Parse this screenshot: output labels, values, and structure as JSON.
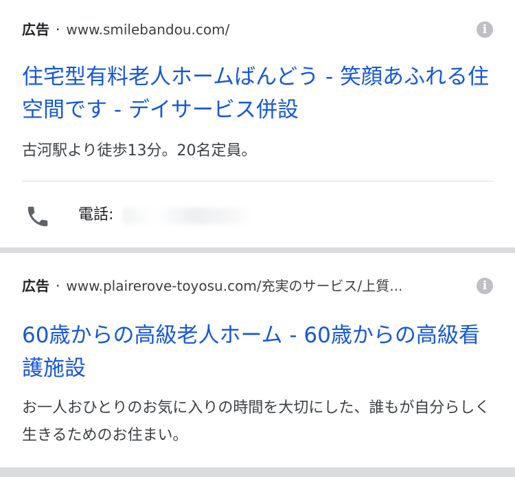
{
  "ads": [
    {
      "label": "広告",
      "separator": "·",
      "url": "www.smilebandou.com/",
      "title": "住宅型有料老人ホームばんどう - 笑顔あふれる住空間です - デイサービス併設",
      "description": "古河駅より徒歩13分。20名定員。",
      "phone_label": "電話:",
      "phone_icon": "phone-icon",
      "info_icon": "info-icon"
    },
    {
      "label": "広告",
      "separator": "·",
      "url": "www.plairerove-toyosu.com/充実のサービス/上質...",
      "title": "60歳からの高級老人ホーム - 60歳からの高級看護施設",
      "description": "お一人おひとりのお気に入りの時間を大切にした、誰もが自分らしく生きるためのお住まい。",
      "info_icon": "info-icon"
    }
  ],
  "colors": {
    "title_link": "#1558d6",
    "text": "#202124",
    "secondary_text": "#3c4043",
    "separator_background": "#dadce0"
  }
}
